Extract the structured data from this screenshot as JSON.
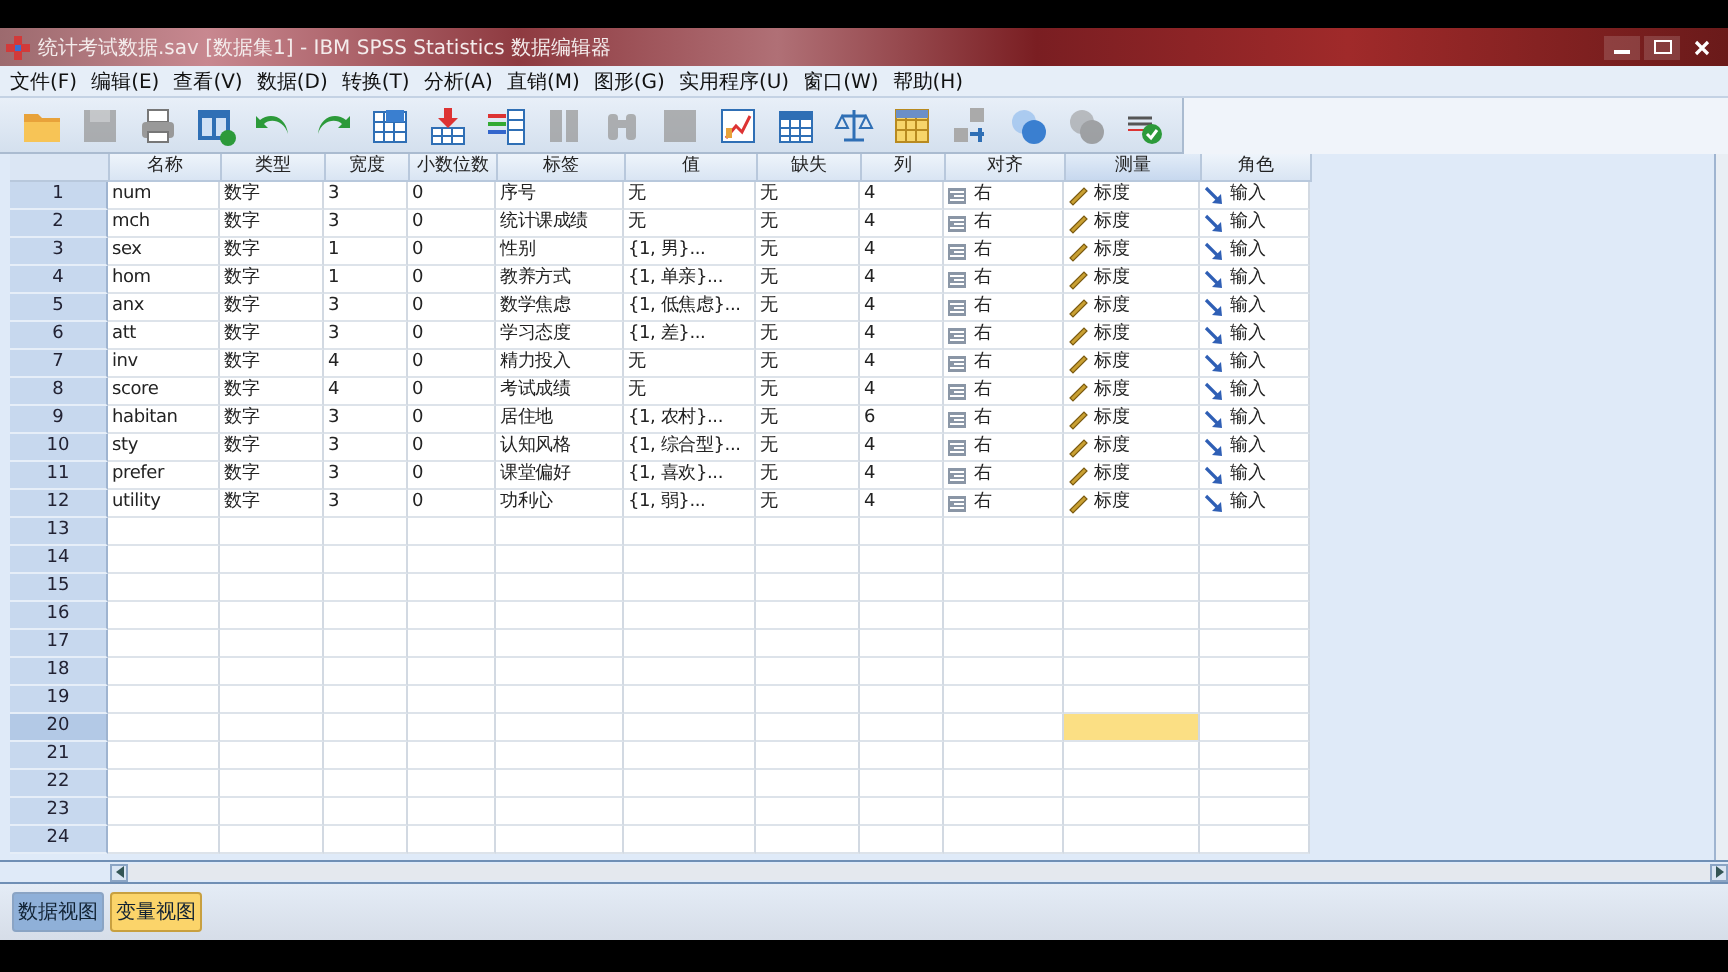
{
  "window": {
    "title": "统计考试数据.sav [数据集1] - IBM SPSS Statistics 数据编辑器"
  },
  "menu": [
    "文件(F)",
    "编辑(E)",
    "查看(V)",
    "数据(D)",
    "转换(T)",
    "分析(A)",
    "直销(M)",
    "图形(G)",
    "实用程序(U)",
    "窗口(W)",
    "帮助(H)"
  ],
  "toolbar": [
    {
      "kind": "folder",
      "disabled": false
    },
    {
      "kind": "save",
      "disabled": true
    },
    {
      "kind": "print",
      "disabled": false
    },
    {
      "kind": "dialog",
      "disabled": false
    },
    {
      "kind": "undo",
      "disabled": false
    },
    {
      "kind": "redo",
      "disabled": false
    },
    {
      "kind": "goto",
      "disabled": false
    },
    {
      "kind": "insert",
      "disabled": false
    },
    {
      "kind": "bars",
      "disabled": false
    },
    {
      "kind": "columns",
      "disabled": true
    },
    {
      "kind": "find",
      "disabled": true
    },
    {
      "kind": "square",
      "disabled": true
    },
    {
      "kind": "chart",
      "disabled": false
    },
    {
      "kind": "grid",
      "disabled": false
    },
    {
      "kind": "scale",
      "disabled": false
    },
    {
      "kind": "table",
      "disabled": false
    },
    {
      "kind": "tiles",
      "disabled": false
    },
    {
      "kind": "circles",
      "disabled": false
    },
    {
      "kind": "circles",
      "disabled": true
    },
    {
      "kind": "spell",
      "disabled": false
    }
  ],
  "table": {
    "columns": [
      {
        "label": "名称",
        "kind": "text",
        "selected": false
      },
      {
        "label": "类型",
        "kind": "text",
        "selected": false
      },
      {
        "label": "宽度",
        "kind": "text",
        "selected": false
      },
      {
        "label": "小数位数",
        "kind": "text",
        "selected": false
      },
      {
        "label": "标签",
        "kind": "text",
        "selected": false
      },
      {
        "label": "值",
        "kind": "text",
        "selected": false
      },
      {
        "label": "缺失",
        "kind": "text",
        "selected": false
      },
      {
        "label": "列",
        "kind": "text",
        "selected": false
      },
      {
        "label": "对齐",
        "kind": "align",
        "selected": false
      },
      {
        "label": "测量",
        "kind": "measure",
        "selected": true
      },
      {
        "label": "角色",
        "kind": "role",
        "selected": false
      }
    ],
    "rows": [
      {
        "number": "1",
        "selected": false,
        "cells": [
          "num",
          "数字",
          "3",
          "0",
          "序号",
          "无",
          "无",
          "4",
          "右",
          "标度",
          "输入"
        ]
      },
      {
        "number": "2",
        "selected": false,
        "cells": [
          "mch",
          "数字",
          "3",
          "0",
          "统计课成绩",
          "无",
          "无",
          "4",
          "右",
          "标度",
          "输入"
        ]
      },
      {
        "number": "3",
        "selected": false,
        "cells": [
          "sex",
          "数字",
          "1",
          "0",
          "性别",
          "{1, 男}...",
          "无",
          "4",
          "右",
          "标度",
          "输入"
        ]
      },
      {
        "number": "4",
        "selected": false,
        "cells": [
          "hom",
          "数字",
          "1",
          "0",
          "教养方式",
          "{1, 单亲}...",
          "无",
          "4",
          "右",
          "标度",
          "输入"
        ]
      },
      {
        "number": "5",
        "selected": false,
        "cells": [
          "anx",
          "数字",
          "3",
          "0",
          "数学焦虑",
          "{1, 低焦虑}...",
          "无",
          "4",
          "右",
          "标度",
          "输入"
        ]
      },
      {
        "number": "6",
        "selected": false,
        "cells": [
          "att",
          "数字",
          "3",
          "0",
          "学习态度",
          "{1, 差}...",
          "无",
          "4",
          "右",
          "标度",
          "输入"
        ]
      },
      {
        "number": "7",
        "selected": false,
        "cells": [
          "inv",
          "数字",
          "4",
          "0",
          "精力投入",
          "无",
          "无",
          "4",
          "右",
          "标度",
          "输入"
        ]
      },
      {
        "number": "8",
        "selected": false,
        "cells": [
          "score",
          "数字",
          "4",
          "0",
          "考试成绩",
          "无",
          "无",
          "4",
          "右",
          "标度",
          "输入"
        ]
      },
      {
        "number": "9",
        "selected": false,
        "cells": [
          "habitan",
          "数字",
          "3",
          "0",
          "居住地",
          "{1, 农村}...",
          "无",
          "6",
          "右",
          "标度",
          "输入"
        ]
      },
      {
        "number": "10",
        "selected": false,
        "cells": [
          "sty",
          "数字",
          "3",
          "0",
          "认知风格",
          "{1, 综合型}...",
          "无",
          "4",
          "右",
          "标度",
          "输入"
        ]
      },
      {
        "number": "11",
        "selected": false,
        "cells": [
          "prefer",
          "数字",
          "3",
          "0",
          "课堂偏好",
          "{1, 喜欢}...",
          "无",
          "4",
          "右",
          "标度",
          "输入"
        ]
      },
      {
        "number": "12",
        "selected": false,
        "cells": [
          "utility",
          "数字",
          "3",
          "0",
          "功利心",
          "{1, 弱}...",
          "无",
          "4",
          "右",
          "标度",
          "输入"
        ]
      },
      {
        "number": "13",
        "selected": false
      },
      {
        "number": "14",
        "selected": false
      },
      {
        "number": "15",
        "selected": false
      },
      {
        "number": "16",
        "selected": false
      },
      {
        "number": "17",
        "selected": false
      },
      {
        "number": "18",
        "selected": false
      },
      {
        "number": "19",
        "selected": false
      },
      {
        "number": "20",
        "selected": true
      },
      {
        "number": "21",
        "selected": false
      },
      {
        "number": "22",
        "selected": false
      },
      {
        "number": "23",
        "selected": false
      },
      {
        "number": "24",
        "selected": false
      }
    ]
  },
  "tabs": [
    {
      "label": "数据视图",
      "selected": false
    },
    {
      "label": "变量视图",
      "selected": true
    }
  ]
}
